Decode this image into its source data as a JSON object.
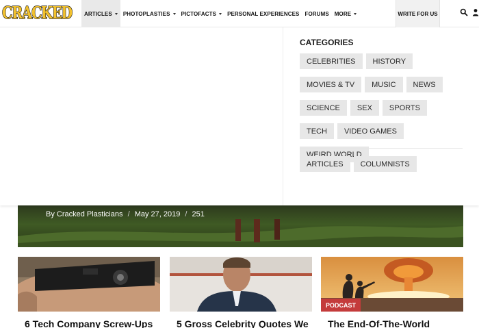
{
  "header": {
    "logo_text": "CRACKED",
    "nav": [
      {
        "label": "ARTICLES",
        "has_caret": true,
        "active": true
      },
      {
        "label": "PHOTOPLASTIES",
        "has_caret": true,
        "active": false
      },
      {
        "label": "PICTOFACTS",
        "has_caret": true,
        "active": false
      },
      {
        "label": "PERSONAL EXPERIENCES",
        "has_caret": false,
        "active": false
      },
      {
        "label": "FORUMS",
        "has_caret": false,
        "active": false
      },
      {
        "label": "MORE",
        "has_caret": true,
        "active": false
      }
    ],
    "write_label": "WRITE FOR US",
    "icons": [
      "search-icon",
      "user-icon"
    ]
  },
  "dropdown": {
    "title": "CATEGORIES",
    "categories": [
      "CELEBRITIES",
      "HISTORY",
      "MOVIES & TV",
      "MUSIC",
      "NEWS",
      "SCIENCE",
      "SEX",
      "SPORTS",
      "TECH",
      "VIDEO GAMES",
      "WEIRD WORLD"
    ],
    "secondary": [
      "ARTICLES",
      "COLUMNISTS"
    ]
  },
  "hero": {
    "author": "By Cracked Plasticians",
    "date": "May 27, 2019",
    "comments": "251",
    "separator": "/"
  },
  "cards": [
    {
      "title": "6 Tech Company Screw-Ups",
      "badge": ""
    },
    {
      "title": "5 Gross Celebrity Quotes We",
      "badge": ""
    },
    {
      "title": "The End-Of-The-World",
      "badge": "PODCAST"
    }
  ],
  "colors": {
    "logo_yellow": "#f2c12e",
    "logo_outline": "#1a1a1a",
    "badge_red": "#c43b3b",
    "tag_bg": "#e7e7e7",
    "active_nav_bg": "#e9e9e9"
  }
}
